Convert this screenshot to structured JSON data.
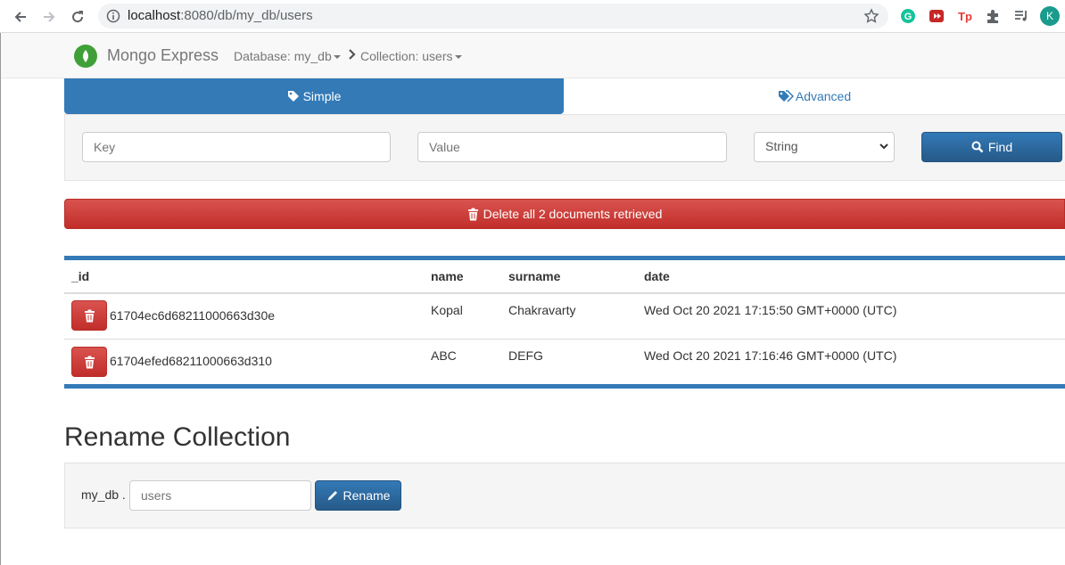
{
  "browser": {
    "url_host": "localhost",
    "url_rest": ":8080/db/my_db/users",
    "profile_initial": "K"
  },
  "navbar": {
    "brand": "Mongo Express",
    "database_crumb": "Database: my_db",
    "collection_crumb": "Collection: users"
  },
  "tabs": {
    "simple": "Simple",
    "advanced": "Advanced"
  },
  "query": {
    "key_placeholder": "Key",
    "value_placeholder": "Value",
    "type_selected": "String",
    "find_label": "Find"
  },
  "delete_all_label": "Delete all 2 documents retrieved",
  "table": {
    "headers": [
      "_id",
      "name",
      "surname",
      "date"
    ],
    "rows": [
      {
        "id": "61704ec6d68211000663d30e",
        "name": "Kopal",
        "surname": "Chakravarty",
        "date": "Wed Oct 20 2021 17:15:50 GMT+0000 (UTC)"
      },
      {
        "id": "61704efed68211000663d310",
        "name": "ABC",
        "surname": "DEFG",
        "date": "Wed Oct 20 2021 17:16:46 GMT+0000 (UTC)"
      }
    ]
  },
  "rename": {
    "heading": "Rename Collection",
    "db_prefix": "my_db .",
    "input_placeholder": "users",
    "button_label": "Rename"
  },
  "colors": {
    "primary": "#337ab7",
    "danger": "#d9534f",
    "mongo_green": "#3fa037"
  }
}
